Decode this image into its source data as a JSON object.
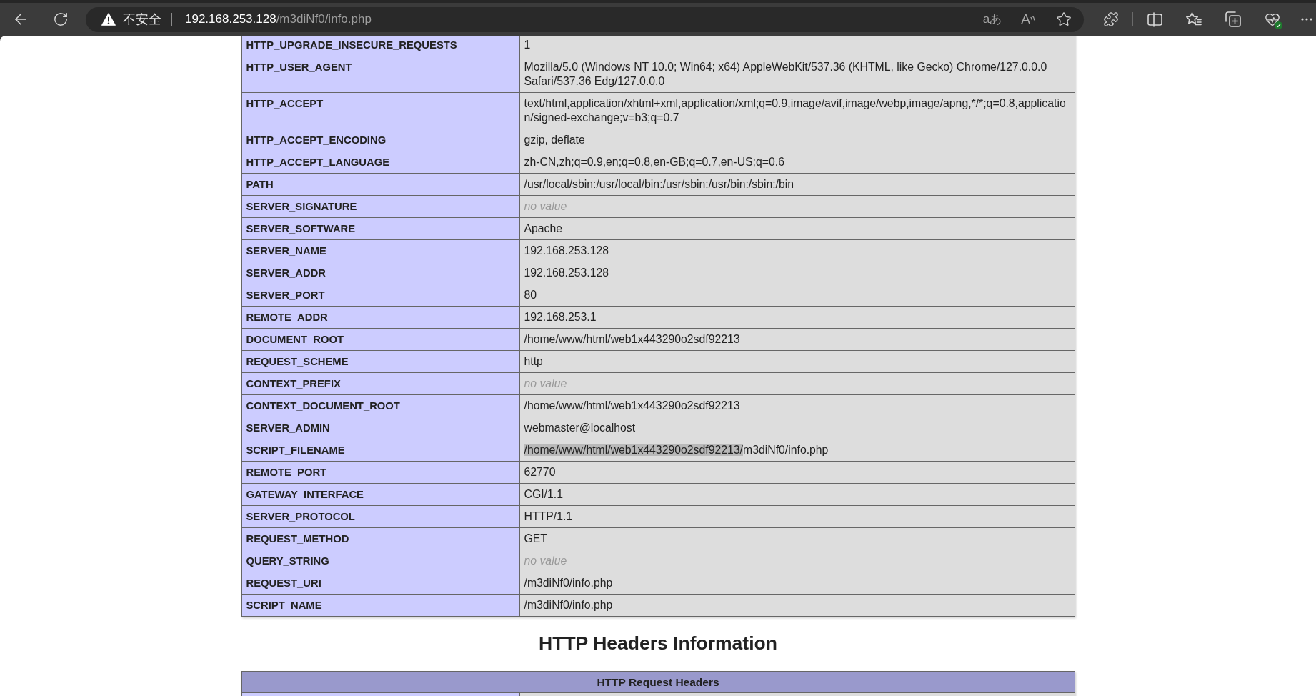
{
  "browser_toolbar": {
    "address_bar": {
      "security_label": "不安全",
      "url_host": "192.168.253.128",
      "url_path": "/m3diNf0/info.php",
      "translate_glyph": "aあ",
      "read_aloud_glyph": "A"
    }
  },
  "environment_table": {
    "rows": [
      {
        "key": "HTTP_UPGRADE_INSECURE_REQUESTS",
        "kind": "text",
        "value": "1"
      },
      {
        "key": "HTTP_USER_AGENT",
        "kind": "text",
        "value": "Mozilla/5.0 (Windows NT 10.0; Win64; x64) AppleWebKit/537.36 (KHTML, like Gecko) Chrome/127.0.0.0 Safari/537.36 Edg/127.0.0.0"
      },
      {
        "key": "HTTP_ACCEPT",
        "kind": "text",
        "value": "text/html,application/xhtml+xml,application/xml;q=0.9,image/avif,image/webp,image/apng,*/*;q=0.8,application/signed-exchange;v=b3;q=0.7"
      },
      {
        "key": "HTTP_ACCEPT_ENCODING",
        "kind": "text",
        "value": "gzip, deflate"
      },
      {
        "key": "HTTP_ACCEPT_LANGUAGE",
        "kind": "text",
        "value": "zh-CN,zh;q=0.9,en;q=0.8,en-GB;q=0.7,en-US;q=0.6"
      },
      {
        "key": "PATH",
        "kind": "text",
        "value": "/usr/local/sbin:/usr/local/bin:/usr/sbin:/usr/bin:/sbin:/bin"
      },
      {
        "key": "SERVER_SIGNATURE",
        "kind": "no_value",
        "value": "no value"
      },
      {
        "key": "SERVER_SOFTWARE",
        "kind": "text",
        "value": "Apache"
      },
      {
        "key": "SERVER_NAME",
        "kind": "text",
        "value": "192.168.253.128"
      },
      {
        "key": "SERVER_ADDR",
        "kind": "text",
        "value": "192.168.253.128"
      },
      {
        "key": "SERVER_PORT",
        "kind": "text",
        "value": "80"
      },
      {
        "key": "REMOTE_ADDR",
        "kind": "text",
        "value": "192.168.253.1"
      },
      {
        "key": "DOCUMENT_ROOT",
        "kind": "text",
        "value": "/home/www/html/web1x443290o2sdf92213"
      },
      {
        "key": "REQUEST_SCHEME",
        "kind": "text",
        "value": "http"
      },
      {
        "key": "CONTEXT_PREFIX",
        "kind": "no_value",
        "value": "no value"
      },
      {
        "key": "CONTEXT_DOCUMENT_ROOT",
        "kind": "text",
        "value": "/home/www/html/web1x443290o2sdf92213"
      },
      {
        "key": "SERVER_ADMIN",
        "kind": "text",
        "value": "webmaster@localhost"
      },
      {
        "key": "SCRIPT_FILENAME",
        "kind": "partly_selected",
        "value_parts": [
          {
            "text": "/home/www/html/web1x443290o2sdf92213/",
            "selected": true
          },
          {
            "text": "m3diNf0/info.php",
            "selected": false
          }
        ]
      },
      {
        "key": "REMOTE_PORT",
        "kind": "text",
        "value": "62770"
      },
      {
        "key": "GATEWAY_INTERFACE",
        "kind": "text",
        "value": "CGI/1.1"
      },
      {
        "key": "SERVER_PROTOCOL",
        "kind": "text",
        "value": "HTTP/1.1"
      },
      {
        "key": "REQUEST_METHOD",
        "kind": "text",
        "value": "GET"
      },
      {
        "key": "QUERY_STRING",
        "kind": "no_value",
        "value": "no value"
      },
      {
        "key": "REQUEST_URI",
        "kind": "text",
        "value": "/m3diNf0/info.php"
      },
      {
        "key": "SCRIPT_NAME",
        "kind": "text",
        "value": "/m3diNf0/info.php"
      }
    ]
  },
  "headers_section": {
    "title": "HTTP Headers Information",
    "table": {
      "header": "HTTP Request Headers"
    }
  }
}
